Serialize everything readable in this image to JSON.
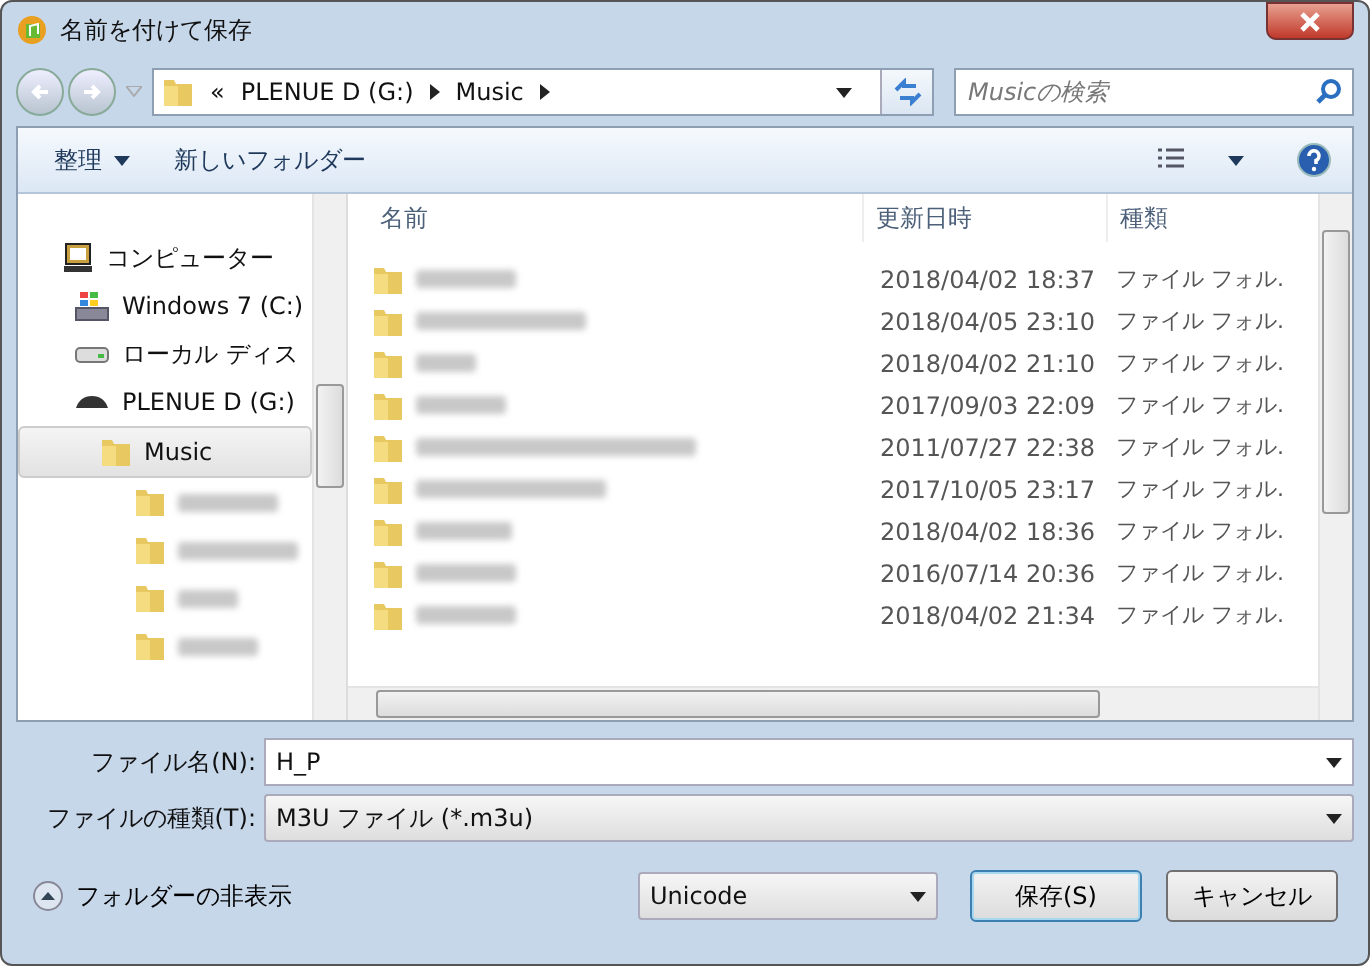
{
  "window": {
    "title": "名前を付けて保存"
  },
  "address": {
    "crumbs": [
      "«",
      "PLENUE D (G:)",
      "Music"
    ]
  },
  "search": {
    "placeholder": "Musicの検索"
  },
  "toolbar": {
    "organize": "整理",
    "new_folder": "新しいフォルダー"
  },
  "sidebar": {
    "items": [
      {
        "label": "コンピューター",
        "kind": "computer",
        "selected": false
      },
      {
        "label": "Windows 7 (C:)",
        "kind": "windows-drive",
        "selected": false
      },
      {
        "label": "ローカル ディス",
        "kind": "drive",
        "selected": false
      },
      {
        "label": "PLENUE D (G:)",
        "kind": "removable",
        "selected": false
      },
      {
        "label": "Music",
        "kind": "folder",
        "selected": true
      }
    ]
  },
  "table": {
    "columns": [
      "名前",
      "更新日時",
      "種類"
    ],
    "rows": [
      {
        "date": "2018/04/02 18:37",
        "type": "ファイル フォル."
      },
      {
        "date": "2018/04/05 23:10",
        "type": "ファイル フォル."
      },
      {
        "date": "2018/04/02 21:10",
        "type": "ファイル フォル."
      },
      {
        "date": "2017/09/03 22:09",
        "type": "ファイル フォル."
      },
      {
        "date": "2011/07/27 22:38",
        "type": "ファイル フォル."
      },
      {
        "date": "2017/10/05 23:17",
        "type": "ファイル フォル."
      },
      {
        "date": "2018/04/02 18:36",
        "type": "ファイル フォル."
      },
      {
        "date": "2016/07/14 20:36",
        "type": "ファイル フォル."
      },
      {
        "date": "2018/04/02 21:34",
        "type": "ファイル フォル."
      }
    ]
  },
  "filename": {
    "label": "ファイル名(N):",
    "value": "H_P"
  },
  "filetype": {
    "label": "ファイルの種類(T):",
    "value": "M3U ファイル (*.m3u)"
  },
  "footer": {
    "hide_folders": "フォルダーの非表示",
    "encoding": "Unicode",
    "save": "保存(S)",
    "cancel": "キャンセル"
  }
}
